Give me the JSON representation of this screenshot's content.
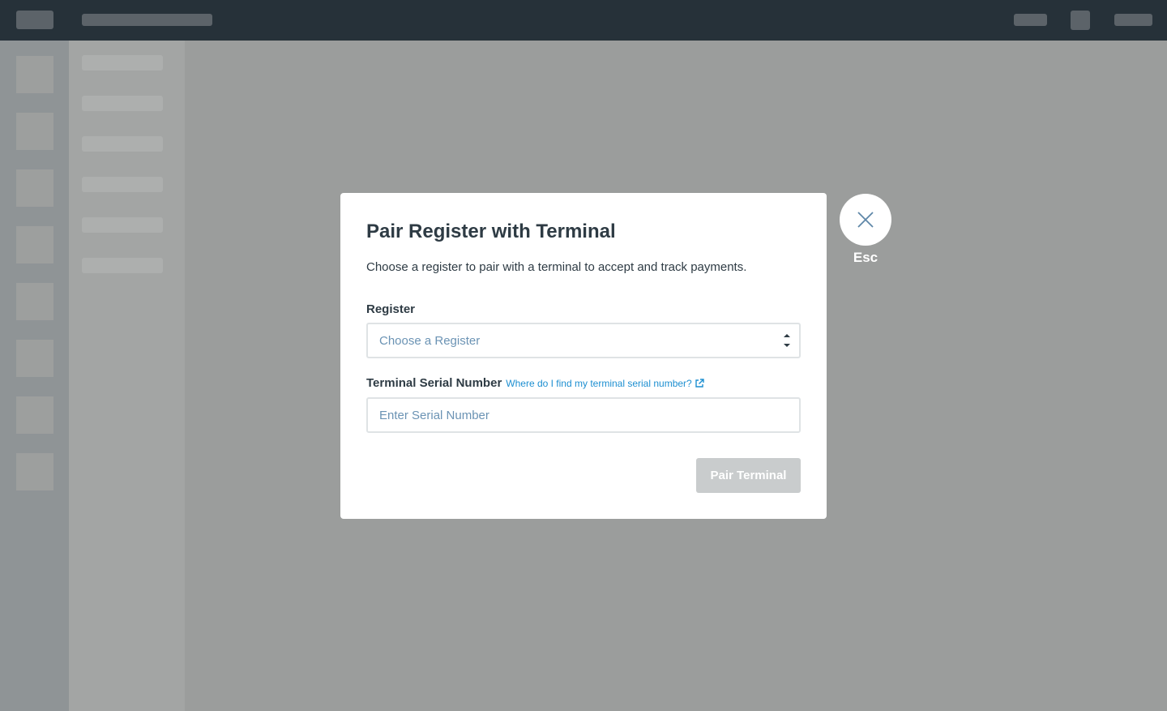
{
  "modal": {
    "title": "Pair Register with Terminal",
    "description": "Choose a register to pair with a terminal to accept and track payments.",
    "register_label": "Register",
    "register_placeholder": "Choose a Register",
    "serial_label": "Terminal Serial Number",
    "serial_help_link": "Where do I find my terminal serial number?",
    "serial_placeholder": "Enter Serial Number",
    "submit_label": "Pair Terminal"
  },
  "close": {
    "label": "Esc",
    "icon": "close-icon"
  },
  "colors": {
    "topbar": "#263139",
    "link": "#1d8fd1",
    "title_text": "#2e3b44",
    "placeholder_text": "#6b93b4",
    "disabled_button": "#c9cccd",
    "backdrop": "#9b9d9c"
  }
}
